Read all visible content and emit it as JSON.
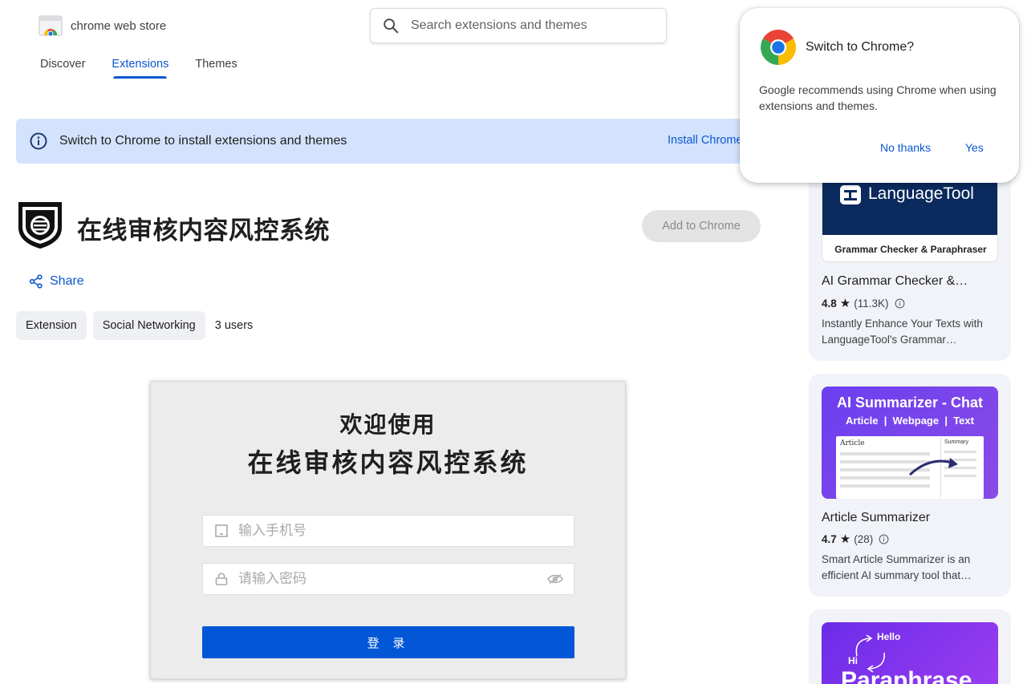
{
  "store": {
    "name": "chrome web store"
  },
  "search": {
    "placeholder": "Search extensions and themes"
  },
  "nav": {
    "tabs": [
      {
        "label": "Discover"
      },
      {
        "label": "Extensions"
      },
      {
        "label": "Themes"
      }
    ],
    "active": "Extensions"
  },
  "banner": {
    "message": "Switch to Chrome to install extensions and themes",
    "install_label": "Install Chrome"
  },
  "extension": {
    "title": "在线审核内容风控系统",
    "add_button": "Add to Chrome",
    "share_label": "Share",
    "chips": [
      "Extension",
      "Social Networking"
    ],
    "users": "3 users"
  },
  "screenshot": {
    "welcome": "欢迎使用",
    "system_name": "在线审核内容风控系统",
    "phone_placeholder": "输入手机号",
    "password_placeholder": "请输入密码",
    "login_label": "登 录"
  },
  "sidebar": {
    "cards": [
      {
        "thumb_title": "LanguageTool",
        "thumb_subtitle": "Grammar Checker & Paraphraser",
        "name": "AI Grammar Checker &…",
        "rating": "4.8",
        "count": "(11.3K)",
        "desc": "Instantly Enhance Your Texts with LanguageTool's Grammar…"
      },
      {
        "thumb_title": "AI Summarizer - Chat",
        "thumb_subtitle": "Article  |  Webpage  |  Text",
        "thumb_left_label": "Article",
        "thumb_right_label": "Summary",
        "name": "Article Summarizer",
        "rating": "4.7",
        "count": "(28)",
        "desc": "Smart Article Summarizer is an efficient AI summary tool that…"
      },
      {
        "thumb_hello": "Hello",
        "thumb_hi": "Hi",
        "thumb_title": "Paraphrase"
      }
    ]
  },
  "popup": {
    "title": "Switch to Chrome?",
    "body": "Google recommends using Chrome when using extensions and themes.",
    "no_label": "No thanks",
    "yes_label": "Yes"
  },
  "colors": {
    "accent": "#0b57d0",
    "banner_bg": "#d3e3fd",
    "login_button": "#0257d7",
    "card_bg": "#f1f3f8"
  }
}
